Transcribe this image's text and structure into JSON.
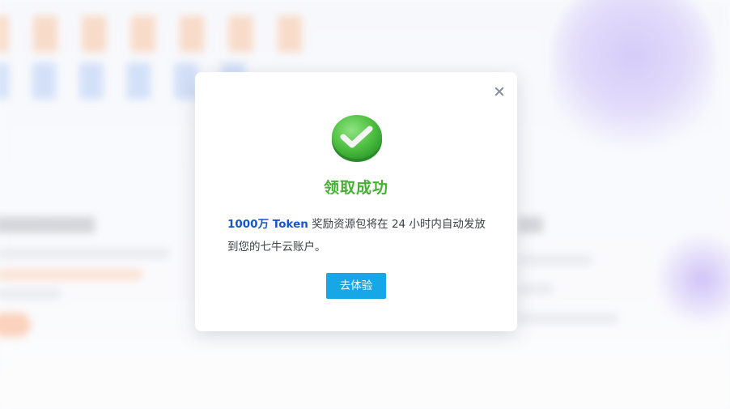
{
  "modal": {
    "title": "领取成功",
    "message_highlight": "1000万 Token",
    "message_rest": " 奖励资源包将在 24 小时内自动发放到您的七牛云账户。",
    "cta_label": "去体验",
    "close_icon": "close-icon",
    "success_icon": "check-circle-icon"
  },
  "colors": {
    "title": "#45b034",
    "highlight": "#1557c7",
    "button": "#17a6e6"
  }
}
